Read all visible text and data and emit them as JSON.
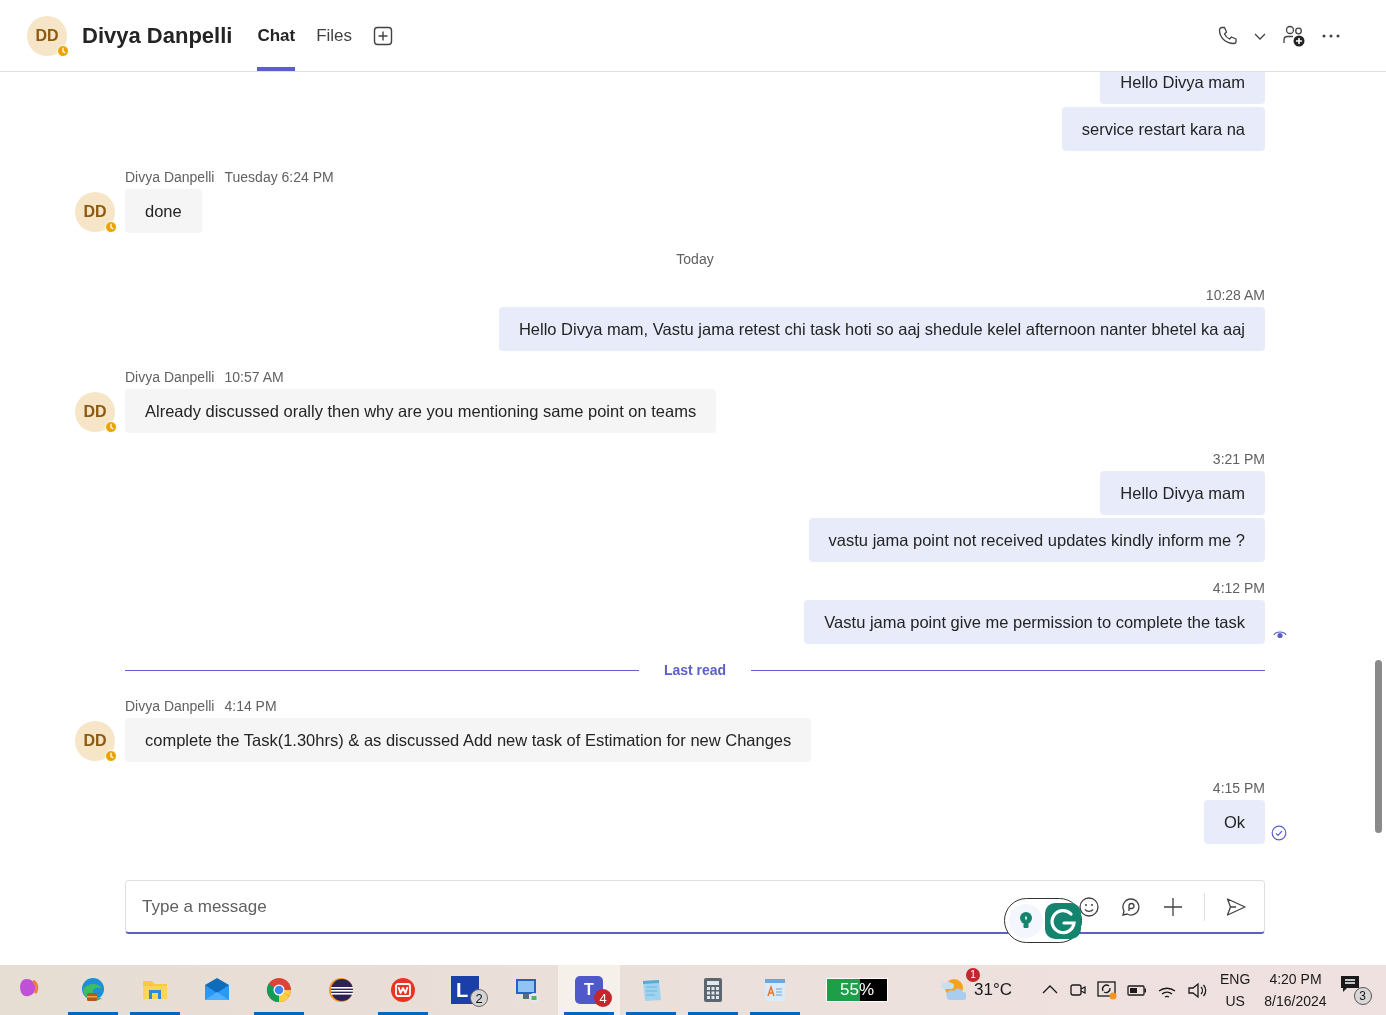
{
  "header": {
    "avatar": {
      "initials": "DD",
      "away": true
    },
    "name": "Divya Danpelli",
    "tabs": [
      {
        "label": "Chat",
        "selected": true
      },
      {
        "label": "Files",
        "selected": false
      }
    ]
  },
  "messages": [
    {
      "kind": "outgoing",
      "bubbles": [
        "Hello Divya mam",
        "service restart kara na"
      ],
      "seen": false,
      "sent": false
    },
    {
      "kind": "incoming",
      "author": "Divya Danpelli",
      "time": "Tuesday 6:24 PM",
      "avatar": {
        "initials": "DD",
        "away": true
      },
      "bubbles": [
        "done"
      ]
    },
    {
      "kind": "date",
      "label": "Today"
    },
    {
      "kind": "outgoing",
      "time": "10:28 AM",
      "bubbles": [
        "Hello Divya mam, Vastu jama retest chi task hoti so aaj shedule kelel afternoon nanter bhetel ka aaj"
      ],
      "seen": false,
      "sent": false
    },
    {
      "kind": "incoming",
      "author": "Divya Danpelli",
      "time": "10:57 AM",
      "avatar": {
        "initials": "DD",
        "away": true
      },
      "bubbles": [
        "Already discussed orally then why are you mentioning same point on teams"
      ]
    },
    {
      "kind": "outgoing",
      "time": "3:21 PM",
      "bubbles": [
        "Hello Divya mam",
        "vastu jama point not received updates kindly inform me ?"
      ],
      "seen": false,
      "sent": false
    },
    {
      "kind": "outgoing",
      "time": "4:12 PM",
      "bubbles": [
        "Vastu jama point give me permission to complete the task"
      ],
      "seen": true,
      "sent": false
    },
    {
      "kind": "divider",
      "label": "Last read"
    },
    {
      "kind": "incoming",
      "author": "Divya Danpelli",
      "time": "4:14 PM",
      "avatar": {
        "initials": "DD",
        "away": true
      },
      "bubbles": [
        "complete the Task(1.30hrs) & as discussed Add new task of Estimation for new Changes"
      ]
    },
    {
      "kind": "outgoing",
      "time": "4:15 PM",
      "bubbles": [
        "Ok"
      ],
      "seen": false,
      "sent": true
    }
  ],
  "compose": {
    "placeholder": "Type a message"
  },
  "taskbar": {
    "apps": [
      {
        "kind": "copilot",
        "running": false,
        "active": false
      },
      {
        "kind": "edge",
        "running": true,
        "active": false
      },
      {
        "kind": "explorer",
        "running": true,
        "active": false
      },
      {
        "kind": "mail",
        "running": false,
        "active": false
      },
      {
        "kind": "chrome",
        "running": true,
        "active": false
      },
      {
        "kind": "eclipse",
        "running": false,
        "active": false
      },
      {
        "kind": "wps",
        "running": true,
        "active": false
      },
      {
        "kind": "launcher",
        "glyph": "L",
        "badge": "2",
        "running": false,
        "active": false
      },
      {
        "kind": "remote",
        "running": false,
        "active": false
      },
      {
        "kind": "teams",
        "glyph": "T",
        "badge": "4",
        "running": true,
        "active": true
      },
      {
        "kind": "notepad",
        "running": true,
        "active": false
      },
      {
        "kind": "calculator",
        "running": true,
        "active": false
      },
      {
        "kind": "wordpad",
        "running": true,
        "active": false
      }
    ],
    "battery": {
      "level": 0.55,
      "reading": "55%"
    },
    "weather": {
      "temperature": "31°C",
      "badge": "1"
    },
    "tray": {
      "language": "ENG",
      "region": "US",
      "time": "4:20 PM",
      "date": "8/16/2024",
      "notifications": "3"
    }
  }
}
